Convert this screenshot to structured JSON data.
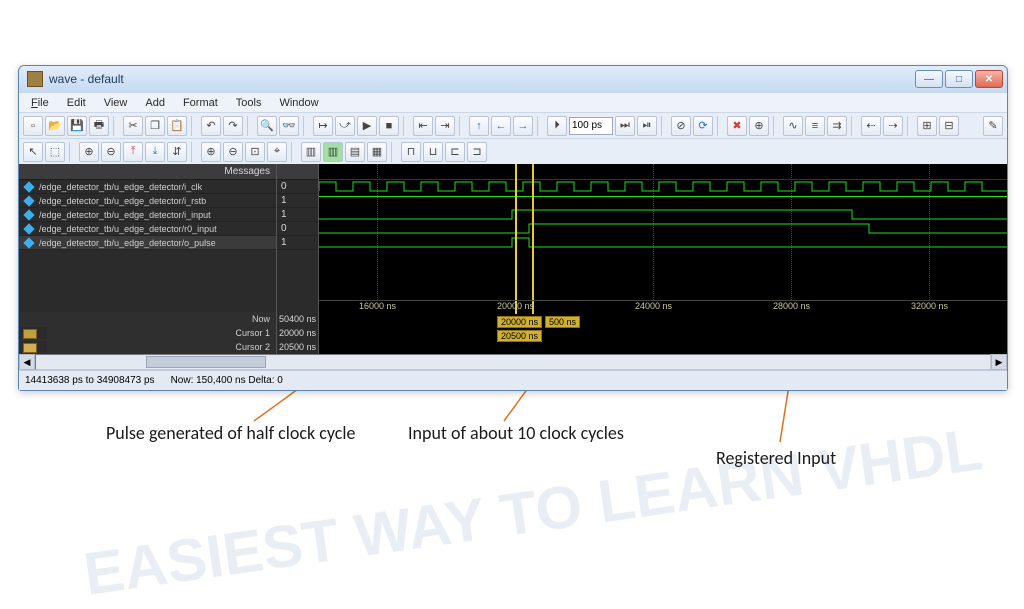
{
  "window": {
    "title": "wave - default"
  },
  "menu": {
    "file": "File",
    "edit": "Edit",
    "view": "View",
    "add": "Add",
    "format": "Format",
    "tools": "Tools",
    "window": "Window"
  },
  "toolbar": {
    "zoom_value": "100 ps"
  },
  "panel": {
    "header": "Messages"
  },
  "signals": [
    {
      "name": "/edge_detector_tb/u_edge_detector/i_clk",
      "value": "0"
    },
    {
      "name": "/edge_detector_tb/u_edge_detector/i_rstb",
      "value": "1"
    },
    {
      "name": "/edge_detector_tb/u_edge_detector/i_input",
      "value": "1"
    },
    {
      "name": "/edge_detector_tb/u_edge_detector/r0_input",
      "value": "0"
    },
    {
      "name": "/edge_detector_tb/u_edge_detector/o_pulse",
      "value": "1"
    }
  ],
  "timeline": {
    "now_label": "Now",
    "now_value": "50400 ns",
    "cursor1_label": "Cursor 1",
    "cursor1_value": "20000 ns",
    "cursor2_label": "Cursor 2",
    "cursor2_value": "20500 ns",
    "ticks": [
      "16000 ns",
      "20000 ns",
      "24000 ns",
      "28000 ns",
      "32000 ns"
    ],
    "cursor_delta": "500 ns"
  },
  "status": {
    "range": "14413638 ps to 34908473 ps",
    "now": "Now: 150,400 ns  Delta: 0"
  },
  "annotations": {
    "a1": "Pulse generated of half clock cycle",
    "a2": "Input of about 10 clock cycles",
    "a3": "Registered Input"
  }
}
